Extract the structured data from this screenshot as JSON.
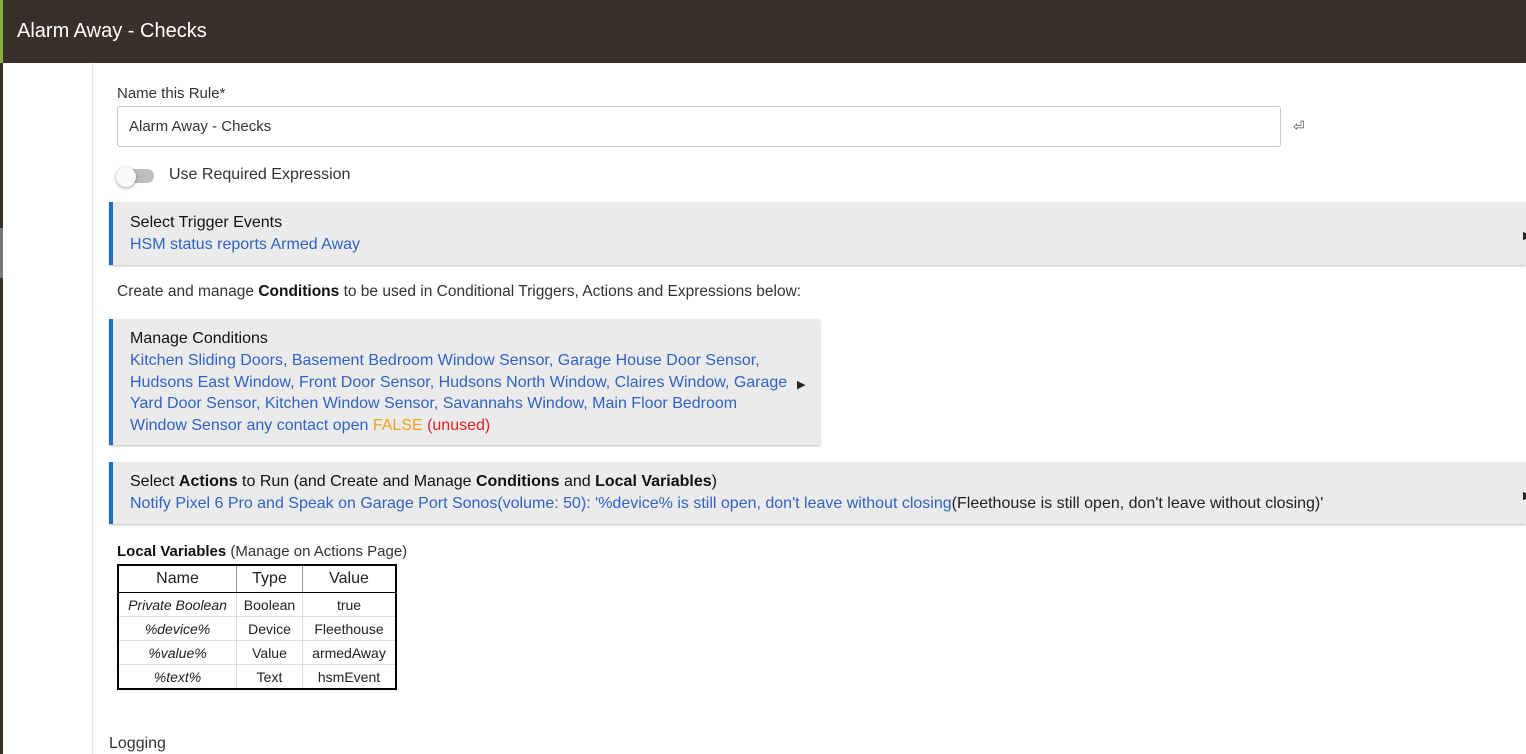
{
  "header": {
    "title": "Alarm Away - Checks"
  },
  "name_field": {
    "label": "Name this Rule*",
    "value": "Alarm Away - Checks",
    "enter_icon": "⏎"
  },
  "required_expression": {
    "label": "Use Required Expression",
    "enabled": false
  },
  "trigger_panel": {
    "title": "Select Trigger Events",
    "summary": "HSM status reports Armed Away"
  },
  "conditions_intro": {
    "pre": "Create and manage ",
    "bold": "Conditions",
    "post": " to be used in Conditional Triggers, Actions and Expressions below:"
  },
  "conditions_panel": {
    "title": "Manage Conditions",
    "line1": "Kitchen Sliding Doors, Basement Bedroom Window Sensor, Garage House Door Sensor,",
    "line2": "Hudsons East Window, Front Door Sensor, Hudsons North Window, Claires Window, Garage",
    "line3": "Yard Door Sensor, Kitchen Window Sensor, Savannahs Window, Main Floor Bedroom",
    "line4": "Window Sensor any contact open ",
    "false_label": "FALSE",
    "unused_label": " (unused)"
  },
  "actions_panel": {
    "t1": "Select ",
    "t2": "Actions",
    "t3": " to Run (and Create and Manage ",
    "t4": "Conditions",
    "t5": " and ",
    "t6": "Local Variables",
    "t7": ")",
    "summary": "Notify Pixel 6 Pro and Speak on Garage Port Sonos(volume: 50): '%device% is still open, don't leave without closing",
    "summary_resolved": "(Fleethouse is still open, don't leave without closing)'"
  },
  "local_variables": {
    "heading": "Local Variables",
    "note": " (Manage on Actions Page)",
    "columns": [
      "Name",
      "Type",
      "Value"
    ],
    "rows": [
      [
        "Private Boolean",
        "Boolean",
        "true"
      ],
      [
        "%device%",
        "Device",
        "Fleethouse"
      ],
      [
        "%value%",
        "Value",
        "armedAway"
      ],
      [
        "%text%",
        "Text",
        "hsmEvent"
      ]
    ]
  },
  "logging": {
    "label": "Logging"
  },
  "colors": {
    "header_bg": "#3b2f2b",
    "accent": "#81b03c",
    "link": "#2f63c5",
    "panel_bar": "#1f6fc5",
    "false": "#f0a020",
    "unused": "#e02020"
  }
}
